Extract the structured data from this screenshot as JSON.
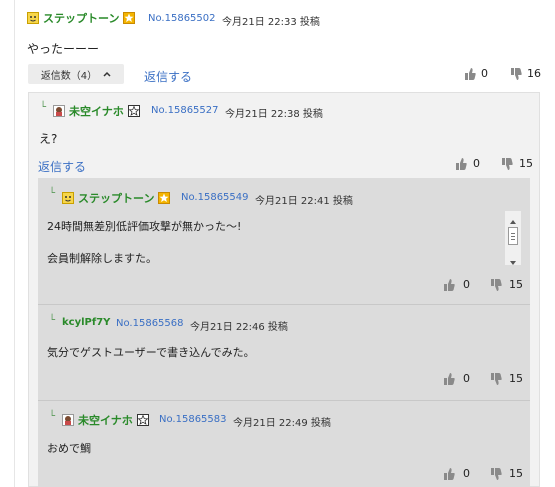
{
  "root_post": {
    "name": "ステップトーン",
    "no": "No.15865502",
    "date": "今月21日 22:33 投稿",
    "body": "やったーーー",
    "reply_count_label": "返信数（4）",
    "reply_link": "返信する",
    "up": "0",
    "down": "16"
  },
  "reply1": {
    "name": "未空イナホ",
    "no": "No.15865527",
    "date": "今月21日 22:38 投稿",
    "body": "え?",
    "reply_link": "返信する",
    "up": "0",
    "down": "15"
  },
  "reply2": {
    "name": "ステップトーン",
    "no": "No.15865549",
    "date": "今月21日 22:41 投稿",
    "body_line1": "24時間無差別低評価攻撃が無かった～!",
    "body_line2": "会員制解除しますた。",
    "up": "0",
    "down": "15"
  },
  "reply3": {
    "name": "kcylPf7Y",
    "no": "No.15865568",
    "date": "今月21日 22:46 投稿",
    "body": "気分でゲストユーザーで書き込んでみた。",
    "up": "0",
    "down": "15"
  },
  "reply4": {
    "name": "未空イナホ",
    "no": "No.15865583",
    "date": "今月21日 22:49 投稿",
    "body": "おめで鯛",
    "up": "0",
    "down": "15"
  },
  "icons": {
    "corner": "└",
    "thumb_up": "thumb-up-icon",
    "thumb_down": "thumb-down-icon"
  },
  "colors": {
    "name": "#2a8a2a",
    "link": "#3a6fc4",
    "panel1": "#f2f2f2",
    "panel2": "#dcdcdc"
  }
}
